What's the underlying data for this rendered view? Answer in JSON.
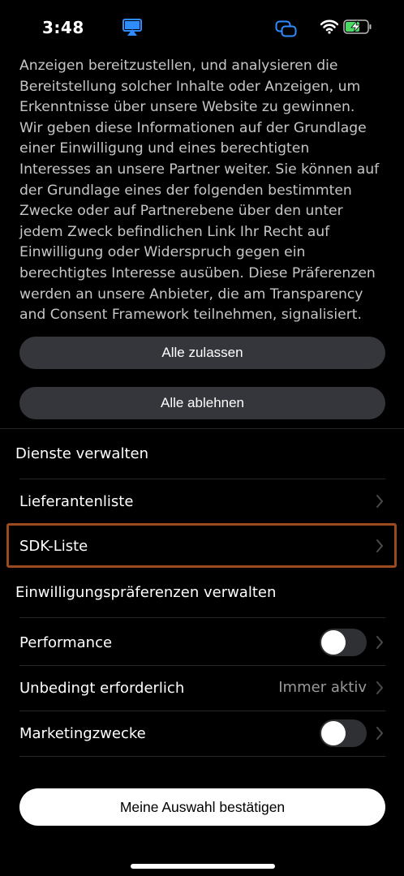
{
  "status_bar": {
    "time": "3:48",
    "icons": [
      "airplay-icon",
      "screen-mirror-icon",
      "wifi-icon",
      "battery-charging-icon"
    ],
    "accent_color": "#2f8cff",
    "battery_color": "#4cd964"
  },
  "consent": {
    "description_lines": [
      "Anzeigen bereitzustellen, und analysieren die",
      "Bereitstellung solcher Inhalte oder Anzeigen, um",
      "Erkenntnisse über unsere Website zu gewinnen.",
      "Wir geben diese Informationen auf der Grundlage",
      "einer Einwilligung und eines berechtigten",
      "Interesses an unsere Partner weiter. Sie können auf",
      "der Grundlage eines der folgenden bestimmten",
      "Zwecke oder auf Partnerebene über den unter",
      "jedem Zweck befindlichen Link Ihr Recht auf",
      "Einwilligung oder Widerspruch gegen ein",
      "berechtigtes Interesse ausüben. Diese Präferenzen",
      "werden an unsere Anbieter, die am Transparency",
      "and Consent Framework teilnehmen, signalisiert."
    ],
    "allow_all_label": "Alle zulassen",
    "reject_all_label": "Alle ablehnen"
  },
  "manage_services": {
    "title": "Dienste verwalten",
    "items": [
      {
        "label": "Lieferantenliste"
      },
      {
        "label": "SDK-Liste"
      }
    ]
  },
  "preferences": {
    "title": "Einwilligungspräferenzen verwalten",
    "items": [
      {
        "label": "Performance",
        "toggle_on": false
      },
      {
        "label": "Unbedingt erforderlich",
        "status": "Immer aktiv"
      },
      {
        "label": "Marketingzwecke",
        "toggle_on": false
      }
    ]
  },
  "confirm_label": "Meine Auswahl bestätigen",
  "highlight_color": "#9a4a1e"
}
